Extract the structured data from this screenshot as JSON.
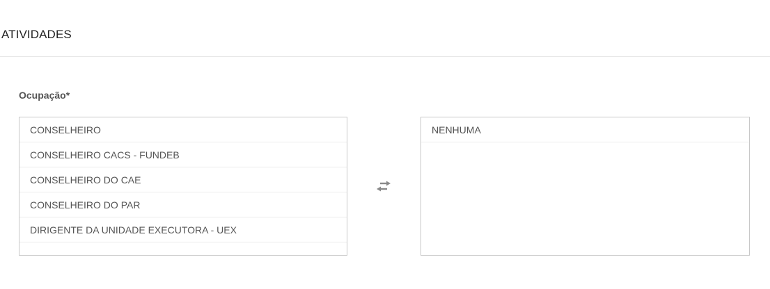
{
  "section": {
    "title": "ATIVIDADES"
  },
  "field": {
    "label": "Ocupação*"
  },
  "available_list": {
    "items": [
      "CONSELHEIRO",
      "CONSELHEIRO CACS - FUNDEB",
      "CONSELHEIRO DO CAE",
      "CONSELHEIRO DO PAR",
      "DIRIGENTE DA UNIDADE EXECUTORA - UEX"
    ]
  },
  "selected_list": {
    "items": [
      "NENHUMA"
    ]
  },
  "icons": {
    "transfer": "exchange-arrows-icon"
  },
  "colors": {
    "border": "#c8c8c8",
    "text": "#555555",
    "icon": "#8a8a8a"
  }
}
